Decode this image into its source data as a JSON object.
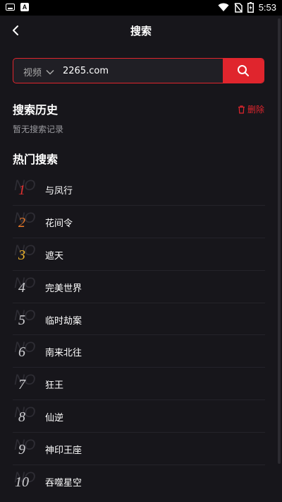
{
  "status_bar": {
    "time": "5:53",
    "icons": [
      "keyboard-icon",
      "a-icon",
      "wifi-icon",
      "no-sim-icon",
      "battery-icon"
    ]
  },
  "header": {
    "title": "搜索",
    "back_icon": "back-arrow-icon"
  },
  "search": {
    "type_label": "视频",
    "query": "2265.com",
    "search_icon": "search-icon"
  },
  "history": {
    "title": "搜索历史",
    "delete_label": "删除",
    "empty_text": "暂无搜索记录"
  },
  "hot": {
    "title": "热门搜索",
    "watermark": "NO",
    "items": [
      {
        "rank": "1",
        "name": "与凤行"
      },
      {
        "rank": "2",
        "name": "花间令"
      },
      {
        "rank": "3",
        "name": "遮天"
      },
      {
        "rank": "4",
        "name": "完美世界"
      },
      {
        "rank": "5",
        "name": "临时劫案"
      },
      {
        "rank": "6",
        "name": "南来北往"
      },
      {
        "rank": "7",
        "name": "狂王"
      },
      {
        "rank": "8",
        "name": "仙逆"
      },
      {
        "rank": "9",
        "name": "神印王座"
      },
      {
        "rank": "10",
        "name": "吞噬星空"
      }
    ]
  },
  "colors": {
    "accent": "#e0252d",
    "background": "#17161b",
    "rank1": "#e2302f",
    "rank2": "#ec7b2a",
    "rank3": "#f0b52c"
  }
}
